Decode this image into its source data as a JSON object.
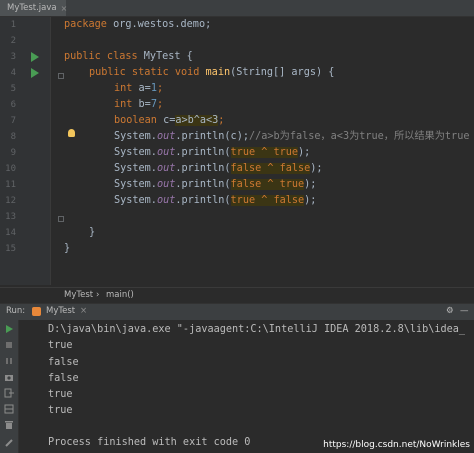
{
  "tab": {
    "file_name": "MyTest.java",
    "close": "×"
  },
  "lines": [
    "1",
    "2",
    "3",
    "4",
    "5",
    "6",
    "7",
    "8",
    "9",
    "10",
    "11",
    "12",
    "13",
    "14",
    "15"
  ],
  "code": {
    "l1_kw": "package",
    "l1_rest": " org.westos.demo;",
    "l3_kw": "public class",
    "l3_rest": " MyTest {",
    "l4_kw1": "public static void",
    "l4_fn": "main",
    "l4_rest": "(String[] args) {",
    "l5_kw": "int",
    "l5_a": " a=",
    "l5_n": "1",
    "l6_kw": "int",
    "l6_b": " b=",
    "l6_n": "7",
    "l7_kw": "boolean",
    "l7_c": " c=",
    "l7_expr": "a>b^a<3",
    "l7_semi": ";",
    "sys": "System.",
    "out": "out",
    "println": ".println(",
    "l8_arg": "c",
    "l8_close": ");",
    "l8_comment": "//a>b为false，a<3为true，所以结果为true",
    "l9_expr": "true ^ true",
    "l10_expr": "false ^ false",
    "l11_expr": "false ^ true",
    "l12_expr": "true ^ false",
    "close_paren": ");",
    "l14": "}",
    "l15": "}"
  },
  "breadcrumb": {
    "class": "MyTest",
    "sep": "›",
    "method": "main()"
  },
  "run_panel": {
    "label": "Run:",
    "config": "MyTest",
    "settings": "⚙",
    "minimize": "—"
  },
  "console": {
    "command": "D:\\java\\bin\\java.exe \"-javaagent:C:\\IntelliJ IDEA 2018.2.8\\lib\\idea_",
    "outputs": [
      "true",
      "false",
      "false",
      "true",
      "true"
    ],
    "finished": "Process finished with exit code 0"
  },
  "watermark": "https://blog.csdn.net/NoWrinkles",
  "colors": {
    "keyword": "#cc7832",
    "number": "#6897bb",
    "function": "#ffc66d",
    "field": "#9876aa",
    "comment": "#808080",
    "run_green": "#499c54"
  }
}
